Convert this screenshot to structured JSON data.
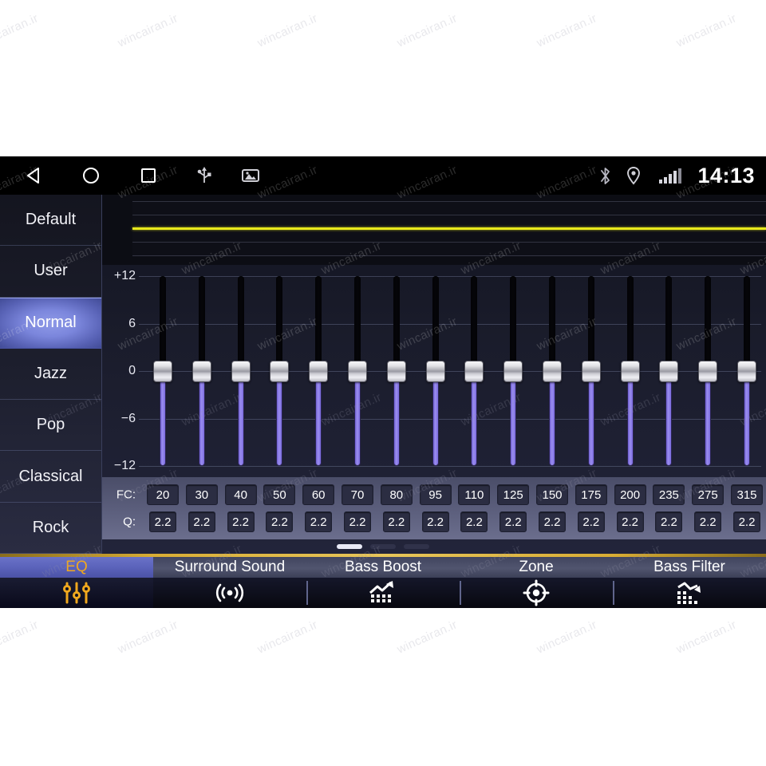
{
  "statusbar": {
    "nav": [
      {
        "name": "back",
        "icon": "back-triangle-icon"
      },
      {
        "name": "home",
        "icon": "home-circle-icon"
      },
      {
        "name": "recents",
        "icon": "recents-square-icon"
      },
      {
        "name": "usb",
        "icon": "usb-icon"
      },
      {
        "name": "sdcard",
        "icon": "sdcard-image-icon"
      }
    ],
    "bluetooth_icon": "bluetooth-icon",
    "location_icon": "location-pin-icon",
    "signal_icon": "signal-bars-icon",
    "clock": "14:13"
  },
  "sidebar": {
    "items": [
      {
        "label": "Default",
        "selected": false
      },
      {
        "label": "User",
        "selected": false
      },
      {
        "label": "Normal",
        "selected": true
      },
      {
        "label": "Jazz",
        "selected": false
      },
      {
        "label": "Pop",
        "selected": false
      },
      {
        "label": "Classical",
        "selected": false
      },
      {
        "label": "Rock",
        "selected": false
      }
    ]
  },
  "graph": {
    "curve_color": "#e8e81c",
    "description": "flat-response-eq-curve"
  },
  "equalizer": {
    "axis_labels": [
      "+12",
      "6",
      "0",
      "-6",
      "-12"
    ],
    "axis_values": [
      12,
      6,
      0,
      -6,
      -12
    ],
    "unit": "dB",
    "fc_row_label": "FC:",
    "q_row_label": "Q:",
    "bands": [
      {
        "fc": "20",
        "q": "2.2",
        "gain": 0
      },
      {
        "fc": "30",
        "q": "2.2",
        "gain": 0
      },
      {
        "fc": "40",
        "q": "2.2",
        "gain": 0
      },
      {
        "fc": "50",
        "q": "2.2",
        "gain": 0
      },
      {
        "fc": "60",
        "q": "2.2",
        "gain": 0
      },
      {
        "fc": "70",
        "q": "2.2",
        "gain": 0
      },
      {
        "fc": "80",
        "q": "2.2",
        "gain": 0
      },
      {
        "fc": "95",
        "q": "2.2",
        "gain": 0
      },
      {
        "fc": "110",
        "q": "2.2",
        "gain": 0
      },
      {
        "fc": "125",
        "q": "2.2",
        "gain": 0
      },
      {
        "fc": "150",
        "q": "2.2",
        "gain": 0
      },
      {
        "fc": "175",
        "q": "2.2",
        "gain": 0
      },
      {
        "fc": "200",
        "q": "2.2",
        "gain": 0
      },
      {
        "fc": "235",
        "q": "2.2",
        "gain": 0
      },
      {
        "fc": "275",
        "q": "2.2",
        "gain": 0
      },
      {
        "fc": "315",
        "q": "2.2",
        "gain": 0
      }
    ]
  },
  "pager": {
    "total": 3,
    "active_index": 0
  },
  "tabs": [
    {
      "label": "EQ",
      "icon": "eq-sliders-icon",
      "selected": true
    },
    {
      "label": "Surround Sound",
      "icon": "surround-waves-icon",
      "selected": false
    },
    {
      "label": "Bass Boost",
      "icon": "bass-boost-rising-icon",
      "selected": false
    },
    {
      "label": "Zone",
      "icon": "zone-target-icon",
      "selected": false
    },
    {
      "label": "Bass Filter",
      "icon": "bass-filter-falling-icon",
      "selected": false
    }
  ],
  "colors": {
    "accent_gold": "#f0a81e",
    "selected_blue": "#5b63bb",
    "slider_purple": "#9b8ef0",
    "curve_yellow": "#e8e81c"
  },
  "watermark": {
    "text": "wincairan.ir"
  }
}
